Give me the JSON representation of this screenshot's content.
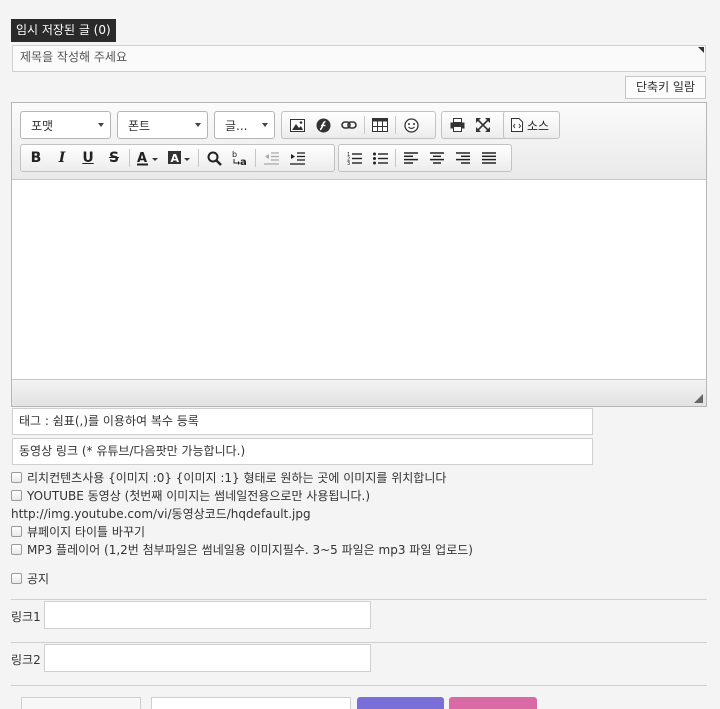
{
  "temp_saved_tab": {
    "label": "임시 저장된 글 (0)"
  },
  "title": {
    "placeholder": "제목을 작성해 주세요"
  },
  "shortcut_button": {
    "label": "단축키 일람"
  },
  "editor": {
    "format_combo": "포맷",
    "font_combo": "폰트",
    "size_combo": "글...",
    "source_label": "소스",
    "icons": [
      "image-icon",
      "flash-icon",
      "link-icon",
      "table-icon",
      "emoticon-icon",
      "print-icon",
      "maximize-icon",
      "source-icon",
      "bold-icon",
      "italic-icon",
      "underline-icon",
      "strikethrough-icon",
      "text-color-icon",
      "background-color-icon",
      "find-icon",
      "replace-icon",
      "outdent-icon",
      "indent-icon",
      "numbered-list-icon",
      "bulleted-list-icon",
      "align-left-icon",
      "align-center-icon",
      "align-right-icon",
      "justify-icon"
    ]
  },
  "tag_field": {
    "text": "태그 : 쉼표(,)를 이용하여 복수 등록"
  },
  "video_field": {
    "text": "동영상 링크 (* 유튜브/다음팟만 가능합니다.)"
  },
  "options": {
    "rich_content": "리치컨텐츠사용 {이미지 :0} {이미지 :1} 형태로 원하는 곳에 이미지를 위치합니다",
    "youtube": "YOUTUBE 동영상 (첫번째 이미지는 썸네일전용으로만 사용됩니다.)",
    "youtube_url": "http://img.youtube.com/vi/동영상코드/hqdefault.jpg",
    "view_title": "뷰페이지 타이틀 바꾸기",
    "mp3": "MP3 플레이어 (1,2번 첨부파일은 썸네일용 이미지필수. 3~5 파일은 mp3 파일 업로드)",
    "notice": "공지"
  },
  "links": {
    "link1_label": "링크1",
    "link2_label": "링크2"
  }
}
